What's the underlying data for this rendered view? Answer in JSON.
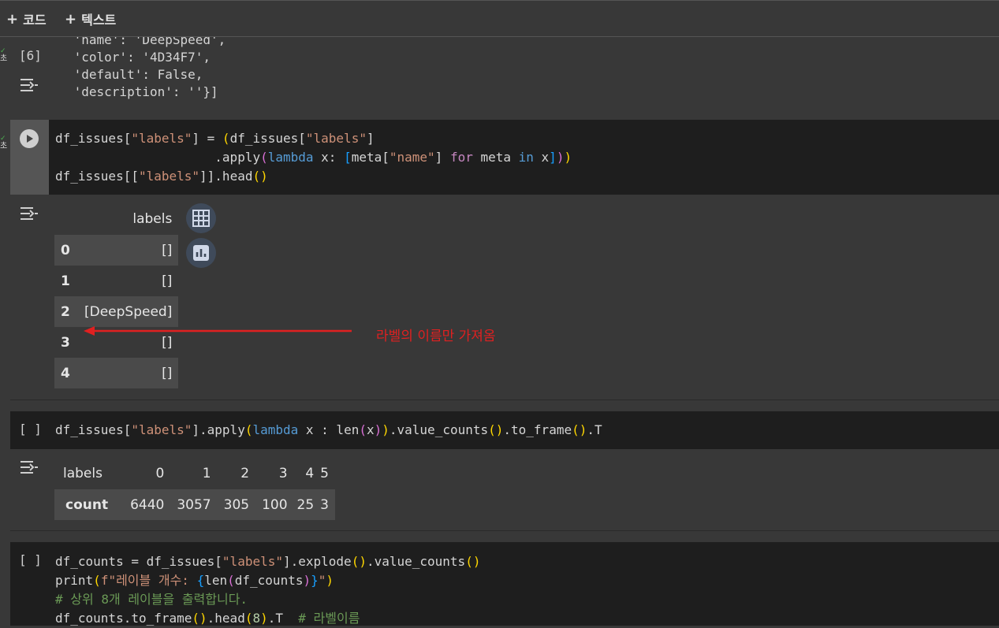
{
  "toolbar": {
    "add_code": "코드",
    "add_text": "텍스트"
  },
  "cell6": {
    "exec_count": "[6]",
    "output_lines": [
      " 'name': 'DeepSpeed',",
      " 'color': '4D34F7',",
      " 'default': False,",
      " 'description': ''}]"
    ]
  },
  "cell7": {
    "annotation": "라벨의 이름만 가져옴",
    "table": {
      "header": "labels",
      "rows": [
        {
          "index": "0",
          "value": "[]"
        },
        {
          "index": "1",
          "value": "[]"
        },
        {
          "index": "2",
          "value": "[DeepSpeed]"
        },
        {
          "index": "3",
          "value": "[]"
        },
        {
          "index": "4",
          "value": "[]"
        }
      ]
    }
  },
  "cell8": {
    "exec_count": "[ ]",
    "table": {
      "header_label": "labels",
      "columns": [
        "0",
        "1",
        "2",
        "3",
        "4",
        "5"
      ],
      "row_label": "count",
      "values": [
        "6440",
        "3057",
        "305",
        "100",
        "25",
        "3"
      ]
    }
  },
  "cell9": {
    "exec_count": "[ ]"
  },
  "colors": {
    "annotation": "#e02020",
    "background": "#383838",
    "code_background": "#1e1e1e"
  }
}
